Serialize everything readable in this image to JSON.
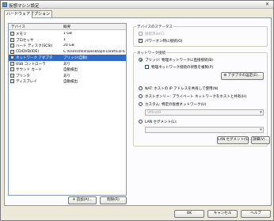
{
  "window": {
    "title": "仮想マシン設定",
    "close_glyph": "✕"
  },
  "tabs": [
    {
      "label": "ハードウェア"
    },
    {
      "label": "オプション"
    }
  ],
  "device_list": {
    "header_device": "デバイス",
    "header_summary": "概要",
    "rows": [
      {
        "name": "メモリ",
        "summary": "1 GB",
        "icon": "memory-icon"
      },
      {
        "name": "プロセッサ",
        "summary": "1",
        "icon": "processor-icon"
      },
      {
        "name": "ハード ディスク(SCSI)",
        "summary": "20 GB",
        "icon": "hard-disk-icon"
      },
      {
        "name": "CD/DVD(IDE)",
        "summary": "C:\\Users\\hkill\\Desktop\\Fcarot\\CD-6.6.6.s...",
        "icon": "cd-dvd-icon"
      },
      {
        "name": "ネットワーク アダプタ",
        "summary": "ブリッジ(自動)",
        "icon": "network-adapter-icon"
      },
      {
        "name": "USB コントローラ",
        "summary": "あり",
        "icon": "usb-icon"
      },
      {
        "name": "サウンド カード",
        "summary": "自動検出",
        "icon": "sound-card-icon"
      },
      {
        "name": "プリンタ",
        "summary": "あり",
        "icon": "printer-icon"
      },
      {
        "name": "ディスプレイ",
        "summary": "自動検出",
        "icon": "display-icon"
      }
    ],
    "selected_index": 4
  },
  "buttons": {
    "add": "追加(A)...",
    "remove": "削除(R)",
    "adapter_settings": "アダプタの設定(E)...",
    "lan_segments": "LAN セグメント(S)...",
    "advanced": "詳細(V)...",
    "ok": "OK",
    "cancel": "キャンセル",
    "help": "ヘルプ"
  },
  "device_status": {
    "group_label": "デバイスのステータス",
    "connected_label": "接続済み(C)",
    "connected_checked": false,
    "power_on_label": "パワーオン時に接続(O)",
    "power_on_checked": true
  },
  "network_connection": {
    "group_label": "ネットワーク接続",
    "options": [
      {
        "label": "ブリッジ: 物理ネットワークに直接接続(B)",
        "checked": true
      },
      {
        "label": "NAT: ホストの IP アドレスを共有して使用(N)",
        "checked": false
      },
      {
        "label": "ホストオンリー: プライベート ネットワークをホストと共有(H)",
        "checked": false
      },
      {
        "label": "カスタム: 特定の仮想ネットワーク(U)",
        "checked": false
      },
      {
        "label": "LAN セグメント(L):",
        "checked": false
      }
    ],
    "replicate_label": "物理ネットワーク接続の状態を複製(P)",
    "replicate_checked": false,
    "custom_select_value": "VMnet0",
    "lan_select_value": ""
  },
  "colors": {
    "selection": "#316ac5",
    "check": "#21a121"
  }
}
